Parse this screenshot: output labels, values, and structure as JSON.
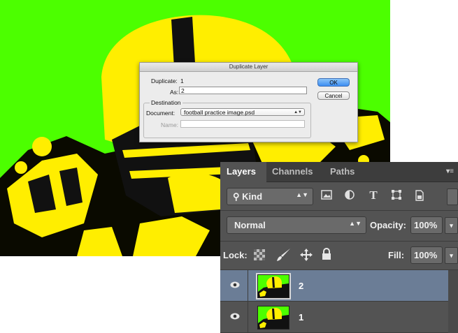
{
  "dialog": {
    "title": "Duplicate Layer",
    "duplicate_label": "Duplicate:",
    "duplicate_value": "1",
    "as_label": "As:",
    "as_value": "2",
    "destination_label": "Destination",
    "document_label": "Document:",
    "document_value": "football practice image.psd",
    "name_label": "Name:",
    "name_value": "",
    "ok_label": "OK",
    "cancel_label": "Cancel"
  },
  "layers_panel": {
    "tabs": [
      {
        "label": "Layers",
        "active": true
      },
      {
        "label": "Channels",
        "active": false
      },
      {
        "label": "Paths",
        "active": false
      }
    ],
    "filter_kind": "Kind",
    "blend_mode": "Normal",
    "opacity_label": "Opacity:",
    "opacity_value": "100%",
    "lock_label": "Lock:",
    "fill_label": "Fill:",
    "fill_value": "100%",
    "filter_icons": [
      "image-filter-icon",
      "adjustment-filter-icon",
      "type-filter-icon",
      "shape-filter-icon",
      "smart-object-filter-icon"
    ],
    "layers": [
      {
        "name": "2",
        "selected": true,
        "visible": true
      },
      {
        "name": "1",
        "selected": false,
        "visible": true
      }
    ]
  },
  "colors": {
    "canvas_green": "#4cff00",
    "helmet_yellow": "#ffee00",
    "panel_bg": "#535353",
    "selected_row": "#6b7d96"
  }
}
